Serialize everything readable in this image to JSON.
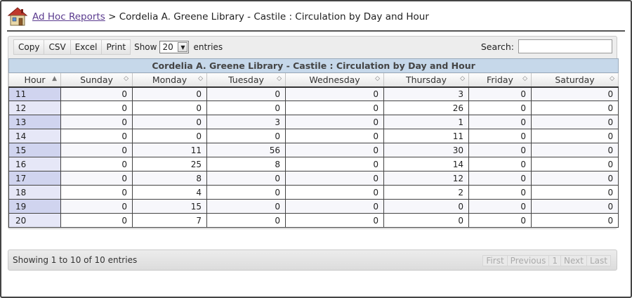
{
  "breadcrumb": {
    "link": "Ad Hoc Reports",
    "separator": ">",
    "current": "Cordelia A. Greene Library - Castile : Circulation by Day and Hour"
  },
  "toolbar": {
    "copy": "Copy",
    "csv": "CSV",
    "excel": "Excel",
    "print": "Print",
    "show_label": "Show",
    "entries_value": "20",
    "entries_label": "entries",
    "search_label": "Search:",
    "search_value": ""
  },
  "table": {
    "caption": "Cordelia A. Greene Library - Castile : Circulation by Day and Hour",
    "columns": [
      "Hour",
      "Sunday",
      "Monday",
      "Tuesday",
      "Wednesday",
      "Thursday",
      "Friday",
      "Saturday"
    ],
    "rows": [
      [
        "11",
        "0",
        "0",
        "0",
        "0",
        "3",
        "0",
        "0"
      ],
      [
        "12",
        "0",
        "0",
        "0",
        "0",
        "26",
        "0",
        "0"
      ],
      [
        "13",
        "0",
        "0",
        "3",
        "0",
        "1",
        "0",
        "0"
      ],
      [
        "14",
        "0",
        "0",
        "0",
        "0",
        "11",
        "0",
        "0"
      ],
      [
        "15",
        "0",
        "11",
        "56",
        "0",
        "30",
        "0",
        "0"
      ],
      [
        "16",
        "0",
        "25",
        "8",
        "0",
        "14",
        "0",
        "0"
      ],
      [
        "17",
        "0",
        "8",
        "0",
        "0",
        "12",
        "0",
        "0"
      ],
      [
        "18",
        "0",
        "4",
        "0",
        "0",
        "2",
        "0",
        "0"
      ],
      [
        "19",
        "0",
        "15",
        "0",
        "0",
        "0",
        "0",
        "0"
      ],
      [
        "20",
        "0",
        "7",
        "0",
        "0",
        "0",
        "0",
        "0"
      ]
    ]
  },
  "footer": {
    "info": "Showing 1 to 10 of 10 entries",
    "pager": [
      "First",
      "Previous",
      "1",
      "Next",
      "Last"
    ]
  },
  "icons": {
    "home": "house-icon",
    "sort_asc": "sort-asc-icon",
    "sort_both": "sort-both-icon",
    "dropdown": "chevron-down-icon"
  }
}
